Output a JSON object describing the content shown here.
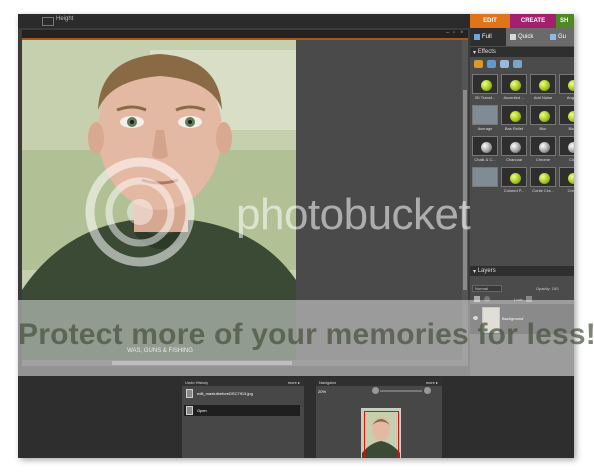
{
  "toolbar": {
    "option_label": "Height"
  },
  "mode_tabs": {
    "edit": "EDIT",
    "create": "CREATE",
    "share": "SH"
  },
  "panel_tabs": {
    "full": "Full",
    "quick": "Quick",
    "guided": "Gu"
  },
  "effects": {
    "title": "Effects",
    "items": [
      "3D Transf...",
      "Accented ...",
      "Add Noise",
      "Angle",
      "Average",
      "Bas Relief",
      "Blur",
      "Blur",
      "Chalk & C...",
      "Charcoal",
      "Chrome",
      "Clo",
      "",
      "Colored P...",
      "Conte Cra...",
      "Crea"
    ]
  },
  "layers": {
    "title": "Layers",
    "blend_mode": "Normal",
    "opacity_label": "Opacity:",
    "opacity_value": "100",
    "lock_label": "Lock:",
    "items": [
      {
        "name": "Background"
      }
    ]
  },
  "undo_history": {
    "title": "Undo History",
    "more": "more ▸",
    "items": [
      "edit_maxtutbeforeDSC7913.jpg",
      "Open"
    ]
  },
  "navigator": {
    "title": "Navigator",
    "more": "more ▸",
    "zoom": "20%"
  },
  "watermark": {
    "brand": "photobucket",
    "tagline": "Protect more of your memories for less!"
  },
  "shirt_text": "WAS, GUNS & FISHING"
}
